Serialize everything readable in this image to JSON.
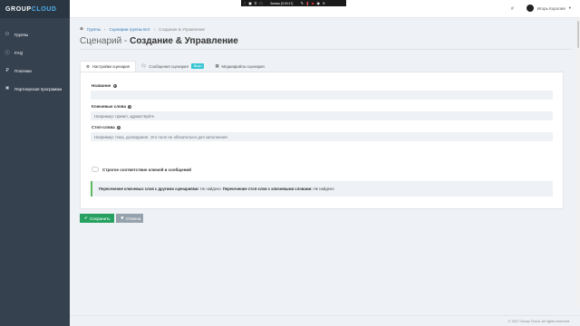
{
  "brand": {
    "group": "GROUP",
    "cloud": "CLOUD"
  },
  "sidebar": {
    "items": [
      {
        "label": "Группы",
        "icon": "users-icon"
      },
      {
        "label": "FAQ",
        "icon": "question-icon"
      },
      {
        "label": "Платежи",
        "icon": "payment-icon"
      },
      {
        "label": "Партнерская программа",
        "icon": "handshake-icon"
      }
    ]
  },
  "recording_bar": {
    "title": "Запись [0:00:17]"
  },
  "user": {
    "name": "Игорь Королев",
    "hash_icon": "#"
  },
  "breadcrumb": {
    "home": "Группы",
    "scenarios": "Сценарии группы Бот",
    "current": "Создание & Управление"
  },
  "page": {
    "title_prefix": "Сценарий - ",
    "title_main": "Создание & Управление"
  },
  "tabs": [
    {
      "label": "Настройки сценария",
      "icon": "gear-icon",
      "active": true
    },
    {
      "label": "Сообщения сценария",
      "icon": "chat-icon",
      "badge": "Выкл"
    },
    {
      "label": "Медиафайлы сценария",
      "icon": "media-icon"
    }
  ],
  "form": {
    "name_label": "Название",
    "name_value": "",
    "keywords_label": "Ключевые слова",
    "keywords_placeholder": "Например: привет, здравствуйте",
    "stopwords_label": "Стоп-слова",
    "stopwords_placeholder": "Например: пока, досвидания. Это поле не обязательно для заполнения",
    "strict_label": "Строгое соответствие ключей и сообщений"
  },
  "note": {
    "part1": "Пересечение ключевых слов с другими сценариями:",
    "part2": "Не найдено",
    "part3": "Пересечение стоп-слов с ключевыми словами:",
    "part4": "Не найдено"
  },
  "buttons": {
    "save": "Сохранить",
    "cancel": "Отмена"
  },
  "footer": {
    "text": "© 2017 Group Cloud. All rights reserved."
  }
}
